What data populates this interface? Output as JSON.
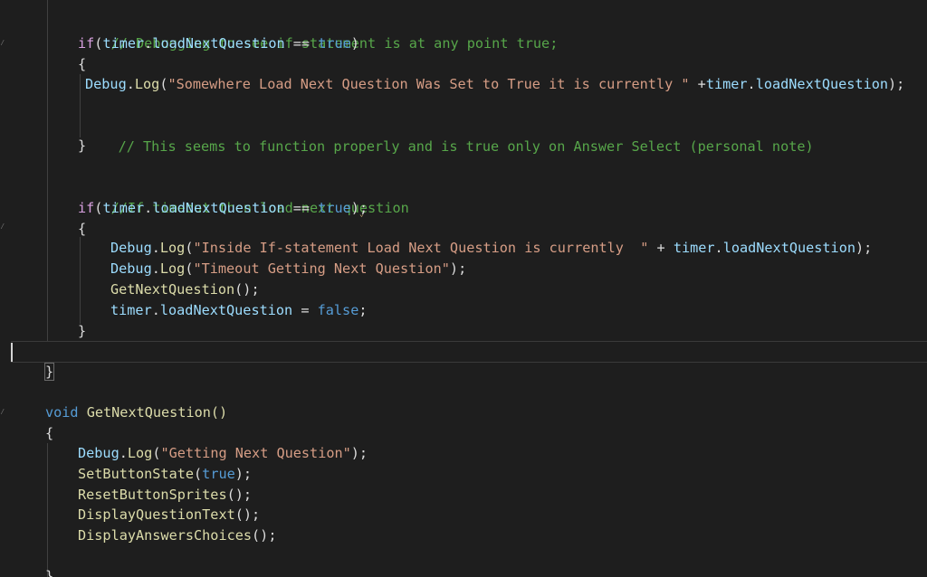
{
  "editor": {
    "colors": {
      "background": "#1e1e1e",
      "comment": "#57a64a",
      "keyword": "#569cd6",
      "control": "#d8a0df",
      "string": "#d69d85",
      "method": "#dcdcaa",
      "variable": "#9cdcfe",
      "plain": "#dcdcdc"
    },
    "code": {
      "comment1": "// Debugging to see if statement is at any point true;",
      "if_kw": "if",
      "timer": "timer",
      "dot": ".",
      "loadNextQuestion": "loadNextQuestion",
      "eq_op": " == ",
      "true_kw": "true",
      "false_kw": "false",
      "open_paren": "(",
      "close_paren": ")",
      "close_paren_semi": ");",
      "semi": ";",
      "open_brace": "{",
      "close_brace": "}",
      "debug": "Debug",
      "log": "Log",
      "str_somewhere": "\"Somewhere Load Next Question Was Set to True it is currently \"",
      "plus_tight": " +",
      "comment2": "// This seems to function properly and is true only on Answer Select (personal note)",
      "comment3": "//If timeout then load next question",
      "str_inside": "\"Inside If-statement Load Next Question is currently  \"",
      "plus_spaced": " + ",
      "str_timeout": "\"Timeout Getting Next Question\"",
      "getNextQuestion": "GetNextQuestion",
      "empty_call": "();",
      "assign_op": " = ",
      "void_kw": "void",
      "space": " ",
      "getNextQuestion_decl": "GetNextQuestion()",
      "str_getting": "\"Getting Next Question\"",
      "setButtonState": "SetButtonState",
      "resetButtonSprites": "ResetButtonSprites",
      "displayQuestionText": "DisplayQuestionText",
      "displayAnswersChoices": "DisplayAnswersChoices"
    }
  }
}
